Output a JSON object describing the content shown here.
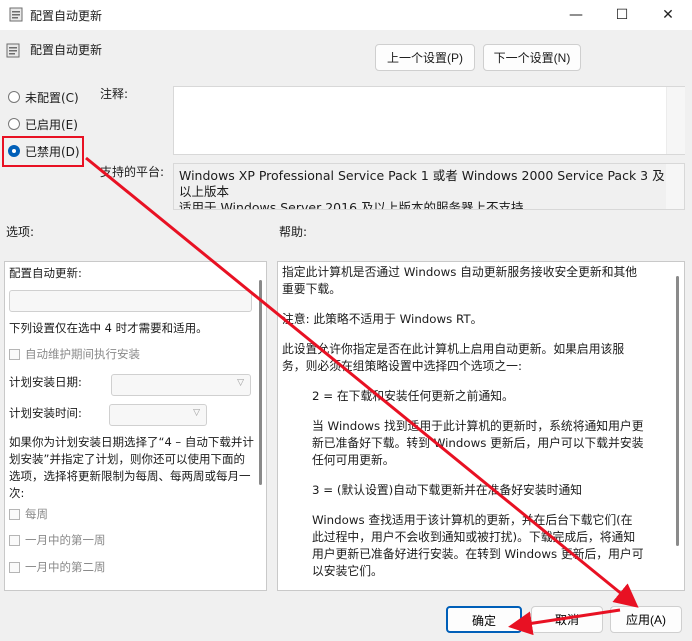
{
  "window": {
    "title": "配置自动更新",
    "controls": {
      "minimize": "—",
      "maximize": "☐",
      "close": "✕"
    }
  },
  "header": {
    "policy_title": "配置自动更新",
    "prev_setting": "上一个设置(P)",
    "next_setting": "下一个设置(N)"
  },
  "state_options": [
    {
      "label": "未配置(C)",
      "selected": false
    },
    {
      "label": "已启用(E)",
      "selected": false
    },
    {
      "label": "已禁用(D)",
      "selected": true
    }
  ],
  "comment": {
    "label": "注释:",
    "value": ""
  },
  "platform": {
    "label": "支持的平台:",
    "text": "Windows XP Professional Service Pack 1 或者 Windows 2000 Service Pack 3 及以上版本",
    "text_cut": "适用于 Windows Server 2016 及以上版本的服务器上不支持"
  },
  "options": {
    "label": "选项:",
    "configure_label": "配置自动更新:",
    "configure_value": "",
    "note": "下列设置仅在选中 4 时才需要和适用。",
    "maint_install": "自动维护期间执行安装",
    "install_day_label": "计划安装日期:",
    "install_time_label": "计划安装时间:",
    "long_note": "如果你为计划安装日期选择了“4 – 自动下载并计划安装”并指定了计划，则你还可以使用下面的选项，选择将更新限制为每周、每两周或每月一次:",
    "weekly": "每周",
    "first_week": "一月中的第一周",
    "second_week": "一月中的第二周"
  },
  "help": {
    "label": "帮助:",
    "p1": "指定此计算机是否通过 Windows 自动更新服务接收安全更新和其他重要下载。",
    "p2": "注意: 此策略不适用于 Windows RT。",
    "p3": "此设置允许你指定是否在此计算机上启用自动更新。如果启用该服务，则必须在组策略设置中选择四个选项之一:",
    "p4": "2 = 在下载和安装任何更新之前通知。",
    "p5": "当 Windows 找到适用于此计算机的更新时，系统将通知用户更新已准备好下载。转到 Windows 更新后，用户可以下载并安装任何可用更新。",
    "p6": "3 = (默认设置)自动下载更新并在准备好安装时通知",
    "p7": "Windows 查找适用于该计算机的更新，并在后台下载它们(在此过程中，用户不会收到通知或被打扰)。下载完成后，将通知用户更新已准备好进行安装。在转到 Windows 更新后，用户可以安装它们。"
  },
  "footer": {
    "ok": "确定",
    "cancel": "取消",
    "apply": "应用(A)"
  },
  "colors": {
    "annotation_red": "#e81123",
    "accent": "#005fb8"
  }
}
